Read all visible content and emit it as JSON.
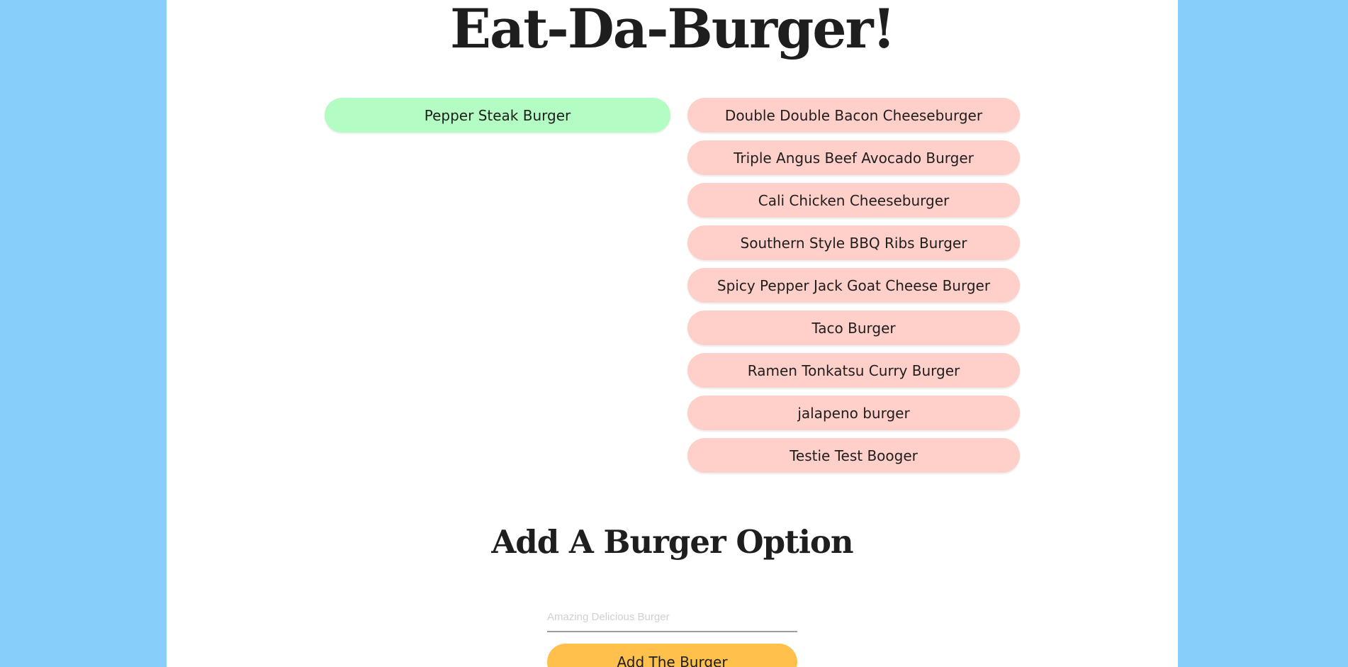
{
  "header": {
    "title": "Eat-Da-Burger!"
  },
  "devoured": {
    "items": [
      "Pepper Steak Burger"
    ]
  },
  "available": {
    "items": [
      "Double Double Bacon Cheeseburger",
      "Triple Angus Beef Avocado Burger",
      "Cali Chicken Cheeseburger",
      "Southern Style BBQ Ribs Burger",
      "Spicy Pepper Jack Goat Cheese Burger",
      "Taco Burger",
      "Ramen Tonkatsu Curry Burger",
      "jalapeno burger",
      "Testie Test Booger"
    ]
  },
  "form": {
    "title": "Add A Burger Option",
    "placeholder": "Amazing Delicious Burger",
    "value": "",
    "button_label": "Add The Burger"
  },
  "colors": {
    "background": "#87cefa",
    "devoured_pill": "#b3fcc3",
    "available_pill": "#ffcfc9",
    "button": "#ffc04c"
  }
}
